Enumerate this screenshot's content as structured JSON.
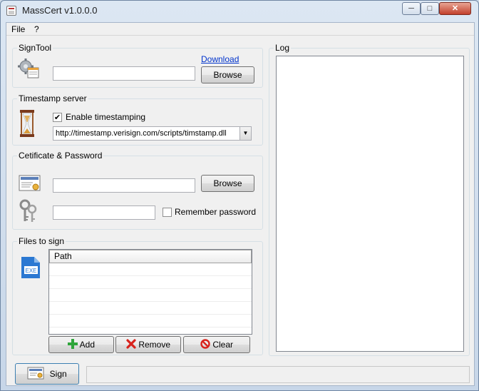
{
  "window": {
    "title": "MassCert v1.0.0.0"
  },
  "menu": {
    "file": "File",
    "help": "?"
  },
  "signtool": {
    "legend": "SignTool",
    "download_link": "Download",
    "path_value": "",
    "browse_label": "Browse"
  },
  "timestamp": {
    "legend": "Timestamp server",
    "enable_label": "Enable timestamping",
    "enabled": true,
    "server_url": "http://timestamp.verisign.com/scripts/timstamp.dll"
  },
  "certificate": {
    "legend": "Cetificate & Password",
    "cert_path": "",
    "browse_label": "Browse",
    "password": "",
    "remember_label": "Remember password",
    "remember": false
  },
  "files": {
    "legend": "Files to sign",
    "column_path": "Path",
    "rows": [
      "",
      "",
      "",
      "",
      "",
      ""
    ],
    "add_label": "Add",
    "remove_label": "Remove",
    "clear_label": "Clear"
  },
  "log": {
    "legend": "Log"
  },
  "footer": {
    "sign_label": "Sign",
    "status_text": ""
  }
}
